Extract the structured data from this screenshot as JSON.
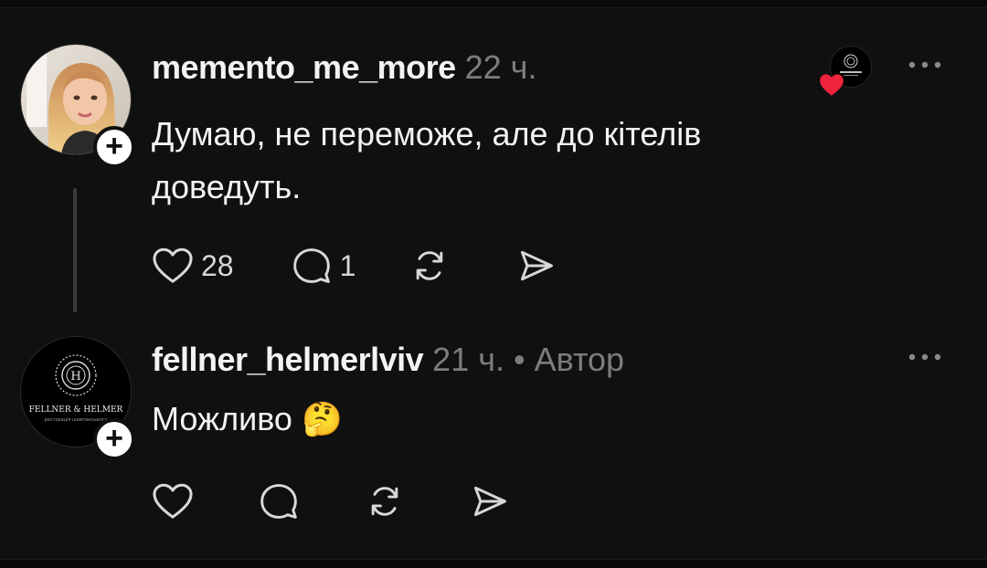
{
  "comments": [
    {
      "username": "memento_me_more",
      "time": "22 ч.",
      "text": "Думаю, не переможе, але до кітелів доведуть.",
      "likes": "28",
      "replies": "1",
      "liked_by_author": true,
      "heart_color": "#ef233c"
    },
    {
      "username": "fellner_helmerlviv",
      "time": "21 ч.",
      "separator": "•",
      "role": "Автор",
      "text": "Можливо",
      "emoji": "🤔",
      "avatar_logo_text": "FELLNER & HELMER",
      "avatar_logo_subtext": "ресторація шампанського"
    }
  ],
  "icons": {
    "like": "heart-outline-icon",
    "reply": "speech-bubble-icon",
    "repost": "repost-arrows-icon",
    "share": "send-arrow-icon",
    "more": "ellipsis-icon",
    "follow": "plus-icon"
  },
  "colors": {
    "background": "#101010",
    "text": "#f3f3f3",
    "muted": "#7d7d7d",
    "icon": "#d8d8d8",
    "heart": "#ef233c"
  }
}
